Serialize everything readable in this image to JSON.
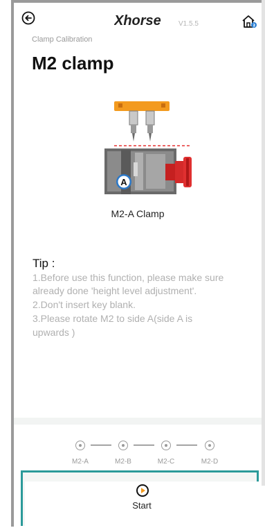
{
  "header": {
    "brand": "Xhorse",
    "version": "V1.5.5",
    "back_icon": "back-arrow-icon",
    "home_icon": "home-icon"
  },
  "breadcrumb": "Clamp Calibration",
  "title": "M2 clamp",
  "figure": {
    "badge": "A",
    "caption": "M2-A Clamp"
  },
  "tip": {
    "title": "Tip :",
    "lines": [
      "1.Before use this function, please make sure",
      "already done 'height level adjustment'.",
      "2.Don't insert key blank.",
      "3.Please rotate M2 to side A(side A is",
      "upwards )"
    ]
  },
  "steps": {
    "current_index": 0,
    "items": [
      {
        "label": "M2-A"
      },
      {
        "label": "M2-B"
      },
      {
        "label": "M2-C"
      },
      {
        "label": "M2-D"
      }
    ]
  },
  "start_button": {
    "label": "Start",
    "icon": "play-circle-icon"
  },
  "colors": {
    "accent_orange": "#f39a1e",
    "panel_border": "#2b9a9a",
    "clamp_red": "#d42a2a",
    "muted_text": "#b0b0b0"
  }
}
